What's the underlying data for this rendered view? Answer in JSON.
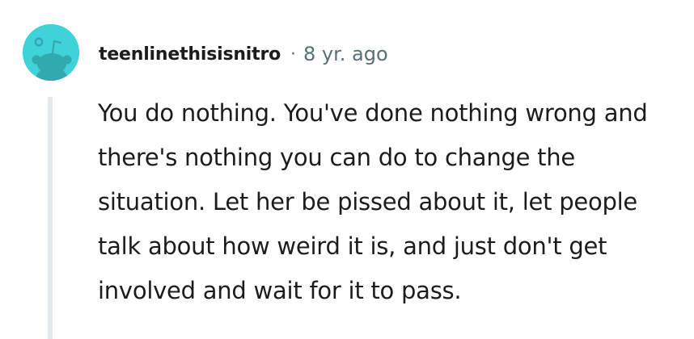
{
  "comment": {
    "author": "teenlinethisisnitro",
    "separator": "·",
    "timestamp": "8 yr. ago",
    "body": "You do nothing. You've done nothing wrong and there's nothing you can do to change the situation. Let her be pissed about it, let people talk about how weird it is, and just don't get involved and wait for it to pass.",
    "avatar_icon": "snoo-avatar-icon"
  },
  "colors": {
    "avatar_bg": "#3fd2d9",
    "text": "#1c1c1c",
    "meta": "#576f76",
    "thread_line": "#e5e9eb"
  }
}
